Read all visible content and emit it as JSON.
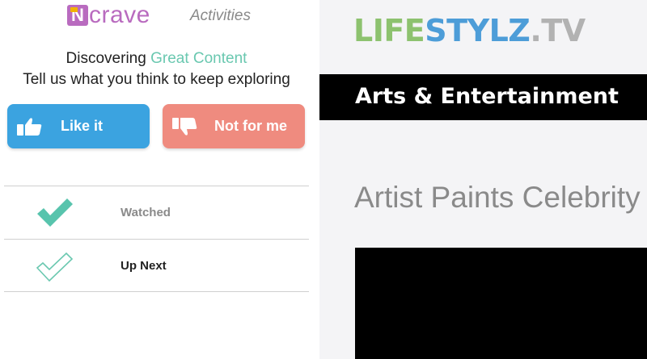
{
  "left_panel": {
    "logo": {
      "letter": "N",
      "text": "crave"
    },
    "activities_label": "Activities",
    "heading": {
      "prefix": "Discovering ",
      "accent": "Great Content"
    },
    "subheading": "Tell us what you think to keep exploring",
    "buttons": {
      "like_label": "Like it",
      "dislike_label": "Not for me"
    },
    "rows": [
      {
        "label": "Watched",
        "icon": "check-solid-icon"
      },
      {
        "label": "Up Next",
        "icon": "check-outline-icon"
      }
    ]
  },
  "right_panel": {
    "brand": {
      "part1": "LIFE",
      "part2": "STYLZ",
      "part3": ".TV"
    },
    "category": "Arts & Entertainment",
    "article_title": "Artist Paints Celebrity"
  },
  "colors": {
    "logo_purple": "#b96bbf",
    "accent_teal": "#6ac8b0",
    "like_blue": "#3ba3e0",
    "dislike_salmon": "#ef8b7f",
    "brand_green": "#8dc26f",
    "brand_blue": "#4d9dd8"
  }
}
